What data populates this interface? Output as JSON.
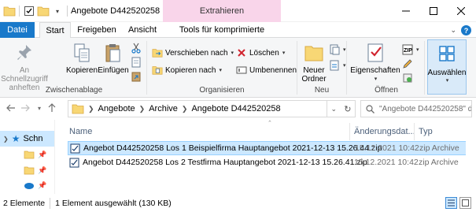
{
  "window": {
    "title": "Angebote D442520258",
    "context_tab_header": "Extrahieren"
  },
  "ribbon_tabs": {
    "file": "Datei",
    "start": "Start",
    "share": "Freigeben",
    "view": "Ansicht",
    "tools": "Tools für komprimierte Ordner"
  },
  "ribbon": {
    "pin_quick_access": "An Schnellzugriff anheften",
    "copy": "Kopieren",
    "paste": "Einfügen",
    "move_to": "Verschieben nach",
    "copy_to": "Kopieren nach",
    "delete": "Löschen",
    "rename": "Umbenennen",
    "new_folder": "Neuer Ordner",
    "properties": "Eigenschaften",
    "select": "Auswählen",
    "groups": {
      "clipboard": "Zwischenablage",
      "organize": "Organisieren",
      "new": "Neu",
      "open": "Öffnen"
    }
  },
  "address": {
    "crumbs": [
      "Angebote",
      "Archive",
      "Angebote D442520258"
    ],
    "search_placeholder": "\"Angebote D442520258\" dur..."
  },
  "navpane": {
    "quick_access": "Schn"
  },
  "columns": {
    "name": "Name",
    "date": "Änderungsdat...",
    "type": "Typ"
  },
  "files": [
    {
      "name": "Angebot D442520258 Los 1 Beispielfirma Hauptangebot 2021-12-13 15.26.44.zip",
      "date": "15.12.2021 10:42",
      "type": "zip Archive",
      "selected": true
    },
    {
      "name": "Angebot D442520258 Los 2 Testfirma Hauptangebot 2021-12-13 15.26.41.zip",
      "date": "15.12.2021 10:42",
      "type": "zip Archive",
      "selected": false
    }
  ],
  "status": {
    "item_count": "2 Elemente",
    "selection": "1 Element ausgewählt (130 KB)"
  },
  "colors": {
    "file_tab": "#1979ca",
    "context_tab": "#f9d5ea",
    "selection": "#cce8ff",
    "folder": "#f8d775"
  }
}
